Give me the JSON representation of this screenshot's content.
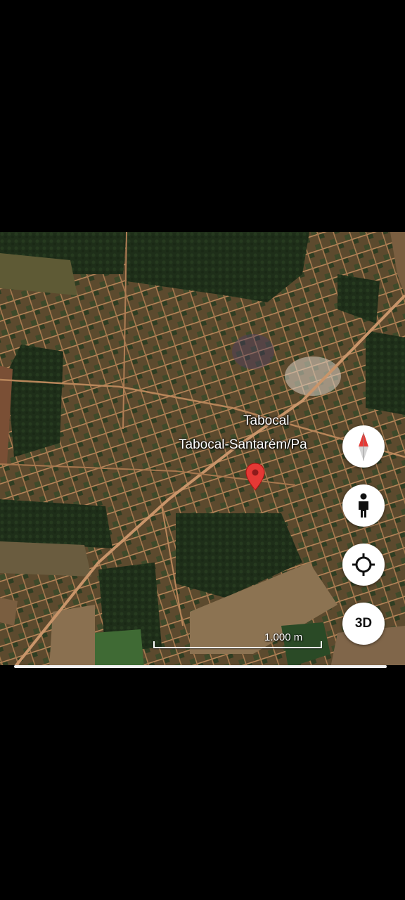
{
  "map": {
    "place_label": "Tabocal",
    "sub_label": "Tabocal-Santarém/Pa",
    "scale_label": "1.000 m",
    "marker_color": "#e53935"
  },
  "controls": {
    "compass_icon": "compass-icon",
    "person_icon": "street-view-person-icon",
    "locate_icon": "my-location-icon",
    "three_d_label": "3D"
  }
}
